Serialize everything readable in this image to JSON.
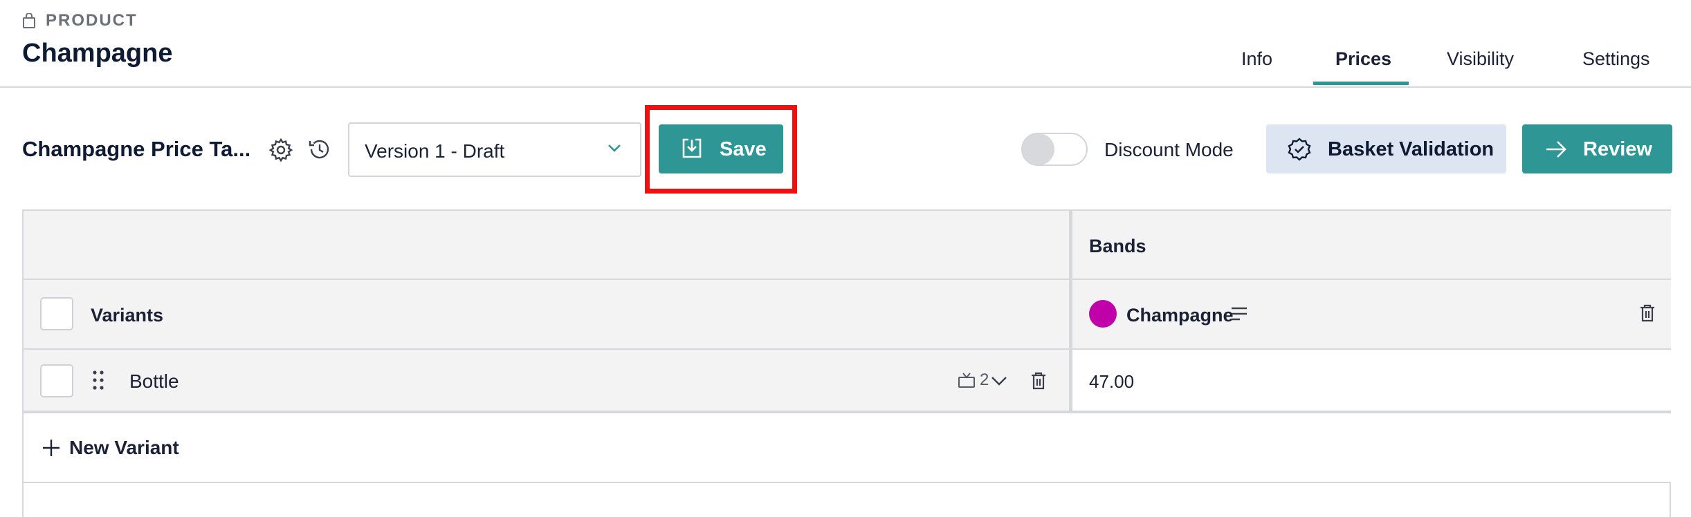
{
  "header": {
    "section_label": "PRODUCT",
    "title": "Champagne",
    "tabs": [
      {
        "label": "Info",
        "active": false
      },
      {
        "label": "Prices",
        "active": true
      },
      {
        "label": "Visibility",
        "active": false
      },
      {
        "label": "Settings",
        "active": false
      }
    ]
  },
  "toolbar": {
    "table_title": "Champagne Price Ta...",
    "version": "Version 1 - Draft",
    "save_label": "Save",
    "discount_mode_label": "Discount Mode",
    "discount_mode_on": false,
    "basket_validation_label": "Basket Validation",
    "review_label": "Review"
  },
  "table": {
    "bands_header": "Bands",
    "variants_header": "Variants",
    "bands": [
      {
        "name": "Champagne",
        "color": "#c000a8"
      }
    ],
    "rows": [
      {
        "variant": "Bottle",
        "count": "2",
        "prices": [
          "47.00"
        ]
      }
    ],
    "new_variant_label": "New Variant"
  },
  "colors": {
    "accent": "#2e9694",
    "highlight": "#ee1111",
    "secondary_button": "#dde5f2"
  }
}
